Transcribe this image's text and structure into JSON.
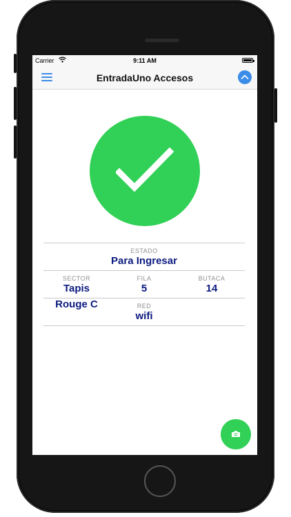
{
  "status_bar": {
    "carrier": "Carrier",
    "time": "9:11 AM"
  },
  "nav": {
    "title": "EntradaUno Accesos"
  },
  "ticket": {
    "estado_label": "ESTADO",
    "estado_value": "Para Ingresar",
    "sector_label": "SECTOR",
    "sector_value_1": "Tapis",
    "sector_value_2": "Rouge C",
    "fila_label": "FILA",
    "fila_value": "5",
    "butaca_label": "BUTACA",
    "butaca_value": "14",
    "red_label": "RED",
    "red_value": "wifi"
  },
  "colors": {
    "accent": "#3b8be8",
    "success": "#31d056",
    "value_text": "#0b1a80"
  },
  "icons": [
    "wifi-icon",
    "battery-icon",
    "menu-icon",
    "chevron-up-icon",
    "checkmark-icon",
    "camera-icon"
  ]
}
